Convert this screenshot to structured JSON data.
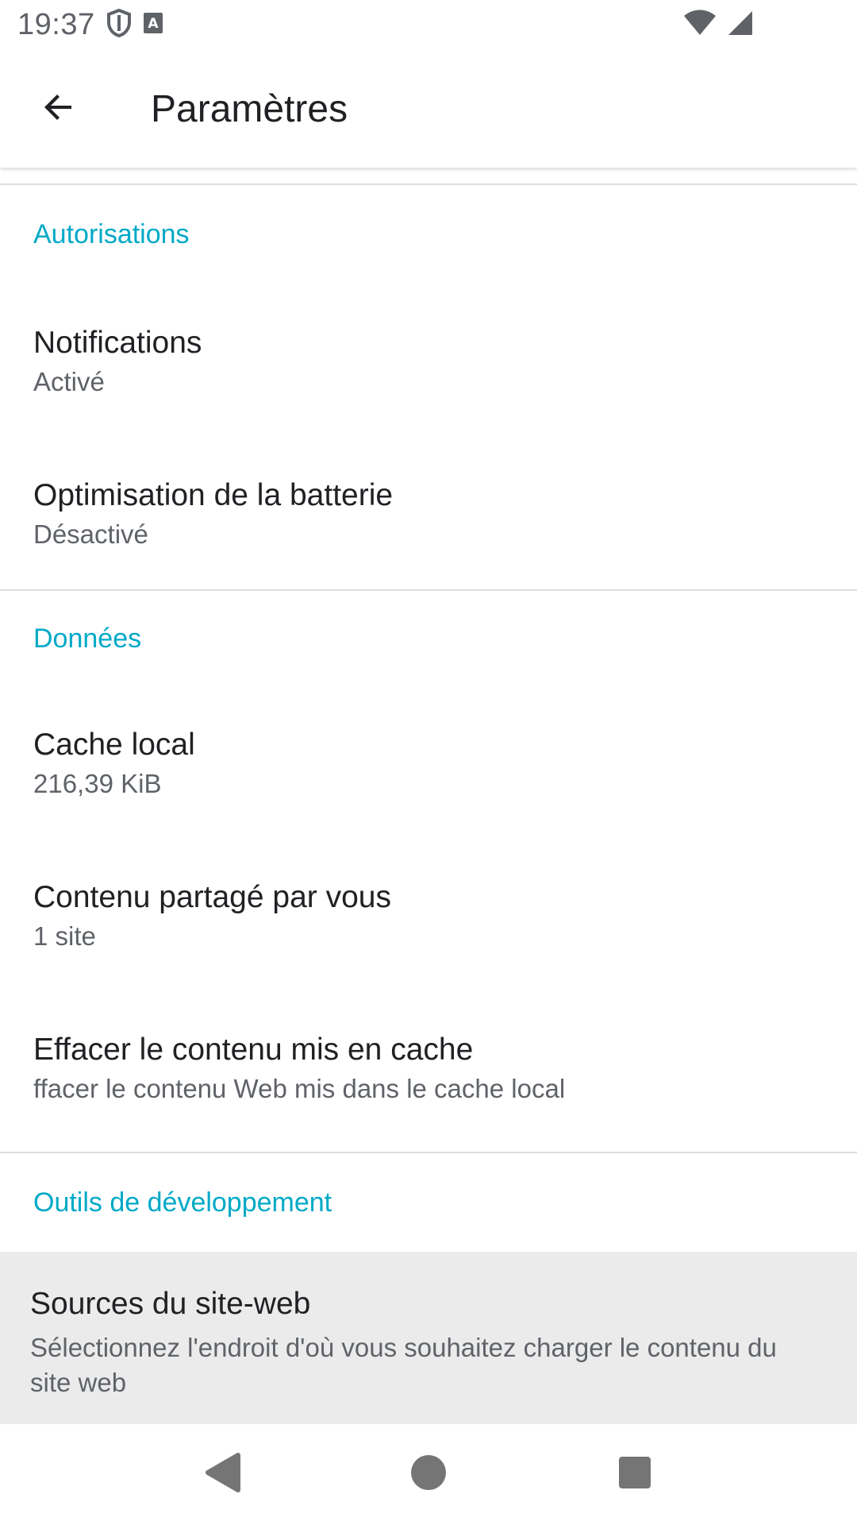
{
  "status_bar": {
    "time": "19:37",
    "icons": [
      "shield-icon",
      "font-a-icon",
      "wifi-icon",
      "signal-icon"
    ]
  },
  "app_bar": {
    "title": "Paramètres",
    "back_icon": "arrow-back-icon"
  },
  "sections": [
    {
      "header": "Autorisations",
      "items": [
        {
          "title": "Notifications",
          "summary": "Activé"
        },
        {
          "title": "Optimisation de la batterie",
          "summary": "Désactivé"
        }
      ]
    },
    {
      "header": "Données",
      "items": [
        {
          "title": "Cache local",
          "summary": "216,39 KiB"
        },
        {
          "title": "Contenu partagé par vous",
          "summary": "1 site"
        },
        {
          "title": "Effacer le contenu mis en cache",
          "summary": "ffacer le contenu Web mis dans le cache local"
        }
      ]
    },
    {
      "header": "Outils de développement",
      "items": [
        {
          "title": "Sources du site-web",
          "summary": "Sélectionnez l'endroit d'où vous souhaitez charger le contenu du site web"
        }
      ]
    }
  ],
  "nav_bar": {
    "icons": [
      "back-triangle-icon",
      "home-circle-icon",
      "recents-square-icon"
    ]
  },
  "colors": {
    "accent": "#00a9c7",
    "highlight_bg": "#ebebeb",
    "divider": "#dedede"
  }
}
